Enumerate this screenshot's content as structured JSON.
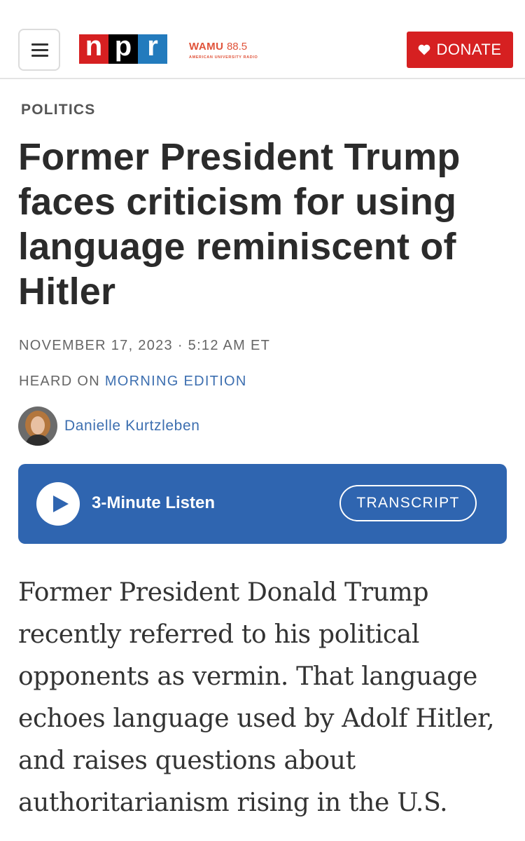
{
  "header": {
    "menu_icon": "hamburger-icon",
    "brand": {
      "n": "n",
      "p": "p",
      "r": "r"
    },
    "station": {
      "name": "WAMU",
      "frequency": "88.5",
      "subtitle": "AMERICAN UNIVERSITY RADIO"
    },
    "donate": {
      "label": "DONATE",
      "icon": "heart-icon"
    }
  },
  "article": {
    "section": "POLITICS",
    "title": "Former President Trump faces criticism for using language reminiscent of Hitler",
    "date": "NOVEMBER 17, 2023 · 5:12 AM ET",
    "heard_on_prefix": "HEARD ON",
    "show": "MORNING EDITION",
    "author": "Danielle Kurtzleben",
    "teaser": "Former President Donald Trump recently referred to his political opponents as vermin. That language echoes language used by Adolf Hitler, and raises questions about authoritarianism rising in the U.S."
  },
  "player": {
    "play_icon": "play-icon",
    "listen_label": "3-Minute Listen",
    "transcript_label": "TRANSCRIPT"
  },
  "colors": {
    "npr_red": "#d62021",
    "npr_black": "#000000",
    "npr_blue": "#237bbd",
    "wamu_orange": "#e0533a",
    "player_blue": "#2f65b0",
    "link_blue": "#3d6fb0"
  }
}
